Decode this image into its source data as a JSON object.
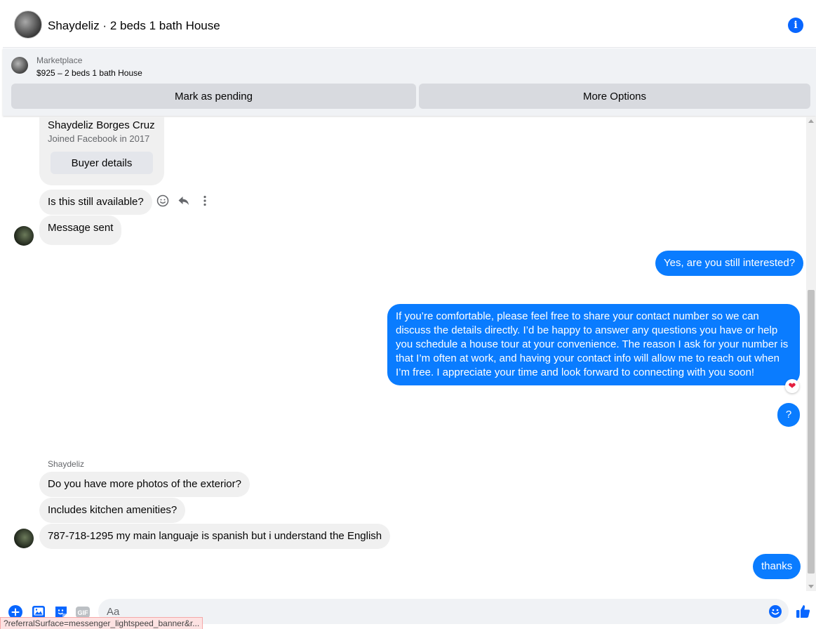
{
  "header": {
    "title": "Shaydeliz · 2 beds 1 bath House"
  },
  "banner": {
    "label": "Marketplace",
    "listing": "$925 – 2 beds 1 bath House",
    "mark_pending": "Mark as pending",
    "more_options": "More Options"
  },
  "buyer": {
    "name": "Shaydeliz Borges Cruz",
    "joined": "Joined Facebook in 2017",
    "details_button": "Buyer details"
  },
  "messages": {
    "m1": "Is this still available?",
    "m2": "Message sent",
    "m3": "Yes, are you still interested?",
    "m4": "If you’re comfortable, please feel free to share your contact number so we can discuss the details directly. I’d be happy to answer any questions you have or help you schedule a house tour at your convenience. The reason I ask for your number is that I’m often at work, and having your contact info will allow me to reach out when I’m free. I appreciate your time and look forward to connecting with you soon!",
    "m5": "?",
    "sender": "Shaydeliz",
    "m6": "Do you have more photos of the exterior?",
    "m7": "Includes kitchen amenities?",
    "m8": "787-718-1295 my main languaje is spanish but i understand the English",
    "m9": "thanks"
  },
  "composer": {
    "placeholder": "Aa"
  },
  "status_url": "?referralSurface=messenger_lightspeed_banner&r...",
  "colors": {
    "accent": "#0866ff",
    "outgoing_bubble": "#0a7cff",
    "incoming_bubble": "#f0f0f0",
    "banner_bg": "#f0f2f5",
    "heart": "#e41e3f"
  },
  "icons": {
    "info": "info-icon",
    "react": "smiley-icon",
    "reply": "reply-icon",
    "more": "more-vertical-icon",
    "plus": "plus-circle-icon",
    "photo": "photo-icon",
    "sticker": "sticker-icon",
    "gif": "gif-icon",
    "emoji": "emoji-icon",
    "like": "thumbs-up-icon",
    "heart": "heart-icon"
  }
}
